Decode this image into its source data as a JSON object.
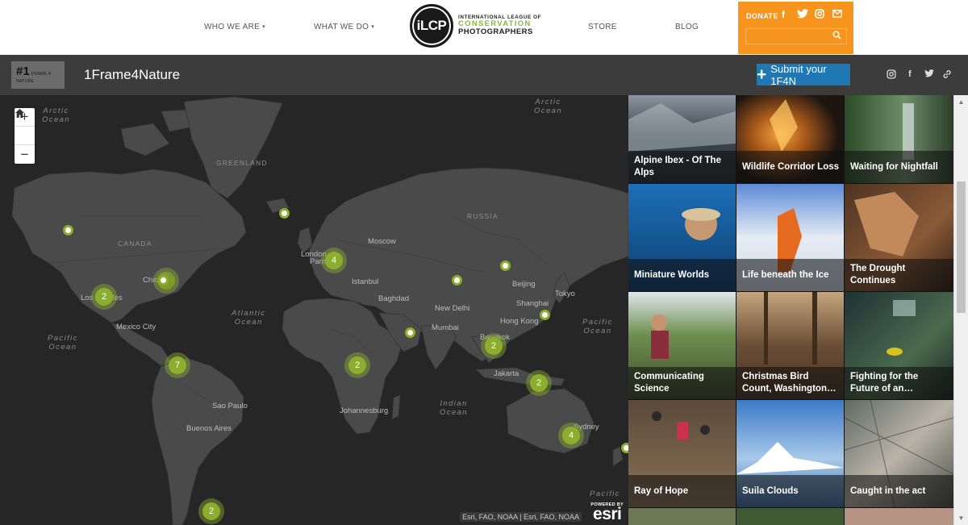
{
  "nav": {
    "who_we_are": "WHO WE ARE",
    "what_we_do": "WHAT WE DO",
    "store": "STORE",
    "blog": "BLOG",
    "caret": "▾",
    "logo_mark_prefix": "iL",
    "logo_mark_suffix": "CP",
    "logo_line1": "INTERNATIONAL LEAGUE OF",
    "logo_line2": "CONSERVATION",
    "logo_line3": "PHOTOGRAPHERS",
    "donate": "DONATE",
    "social_icons": [
      "facebook-icon",
      "twitter-icon",
      "instagram-icon",
      "mail-icon"
    ],
    "search_icon": "search-icon",
    "accent_color": "#f7941d"
  },
  "app": {
    "logo_hash": "#1",
    "logo_text": "FRAME 4 NATURE",
    "title": "1Frame4Nature",
    "submit_label": "Submit your 1F4N",
    "submit_icon": "plus-icon",
    "social_icons": [
      "instagram-icon",
      "facebook-icon",
      "twitter-icon",
      "link-icon"
    ]
  },
  "map": {
    "zoom_in": "+",
    "zoom_out": "−",
    "home_icon": "home-icon",
    "oceans": [
      {
        "text": "Arctic\nOcean"
      },
      {
        "text": "Arctic\nOcean"
      },
      {
        "text": "Atlantic\nOcean"
      },
      {
        "text": "Pacific\nOcean"
      },
      {
        "text": "Pacific\nOcean"
      },
      {
        "text": "Indian\nOcean"
      },
      {
        "text": "Pacific"
      }
    ],
    "regions": [
      "GREENLAND",
      "CANADA",
      "RUSSIA"
    ],
    "cities": [
      "Chicago",
      "Los Angeles",
      "Mexico City",
      "Sao Paulo",
      "Buenos Aires",
      "London",
      "Paris",
      "Moscow",
      "Istanbul",
      "Baghdad",
      "New Delhi",
      "Mumbai",
      "Beijing",
      "Shanghai",
      "Tokyo",
      "Hong Kong",
      "Bangkok",
      "Jakarta",
      "Johannesburg",
      "Sydney"
    ],
    "clusters": [
      "2",
      "4",
      "7",
      "2",
      "2",
      "2",
      "4",
      "2"
    ],
    "points": 8,
    "attribution": "Esri, FAO, NOAA | Esri, FAO, NOAA",
    "esri_powered": "POWERED BY",
    "esri_logo": "esri",
    "cluster_color": "#8cae2e"
  },
  "gallery": {
    "tiles": [
      {
        "title": "Alpine Ibex - Of The Alps"
      },
      {
        "title": "Wildlife Corridor Loss"
      },
      {
        "title": "Waiting for Nightfall"
      },
      {
        "title": "Miniature Worlds"
      },
      {
        "title": "Life beneath the Ice"
      },
      {
        "title": "The Drought Continues"
      },
      {
        "title": "Communicating Science"
      },
      {
        "title": "Christmas Bird Count, Washington…"
      },
      {
        "title": "Fighting for the Future of an…"
      },
      {
        "title": "Ray of Hope"
      },
      {
        "title": "Suila Clouds"
      },
      {
        "title": "Caught in the act"
      }
    ]
  },
  "scrollbar": {
    "up_icon": "▲",
    "down_icon": "▼"
  }
}
